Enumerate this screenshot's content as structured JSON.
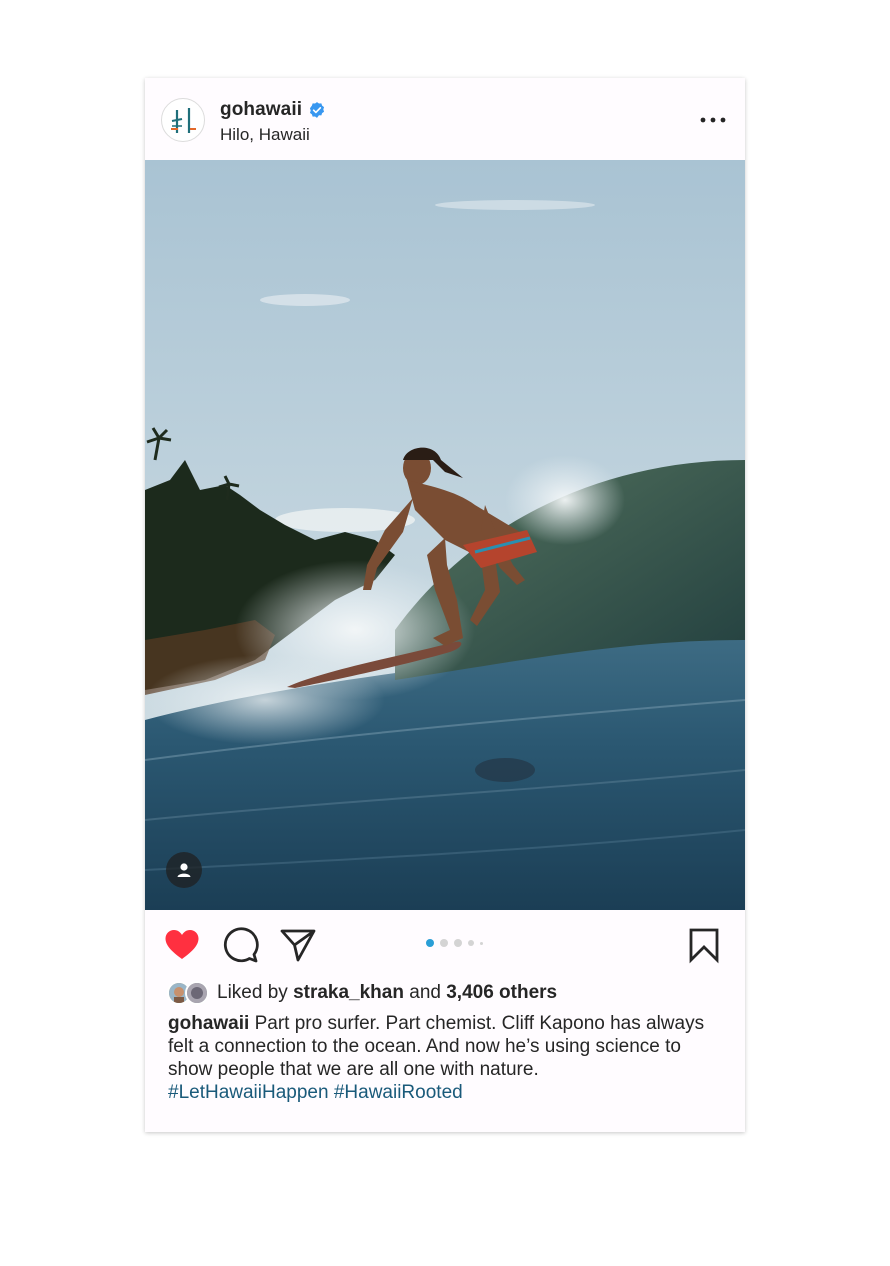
{
  "post": {
    "username": "gohawaii",
    "verified": true,
    "location": "Hilo, Hawaii",
    "avatar_logo": "HI",
    "image_alt": "surfer riding a wave",
    "carousel": {
      "count": 5,
      "active_index": 0
    },
    "likes": {
      "prefix": "Liked by",
      "liker": "straka_khan",
      "joiner": "and",
      "others": "3,406 others"
    },
    "caption": {
      "username": "gohawaii",
      "text": "Part pro surfer. Part chemist. Cliff Kapono has always felt a connection to the ocean. And now he’s using science to show people that we are all one with nature.",
      "hashtags": [
        "#LetHawaiiHappen",
        "#HawaiiRooted"
      ]
    }
  },
  "icons": {
    "like": "heart-filled-icon",
    "comment": "comment-icon",
    "share": "paper-plane-icon",
    "save": "bookmark-icon",
    "more": "more-dots-icon",
    "tag": "user-tag-icon",
    "verified": "verified-badge-icon"
  },
  "colors": {
    "like_red": "#ff3040",
    "verified_blue": "#3897f0",
    "carousel_active": "#2a9fd6",
    "hashtag": "#1a5a7a"
  }
}
